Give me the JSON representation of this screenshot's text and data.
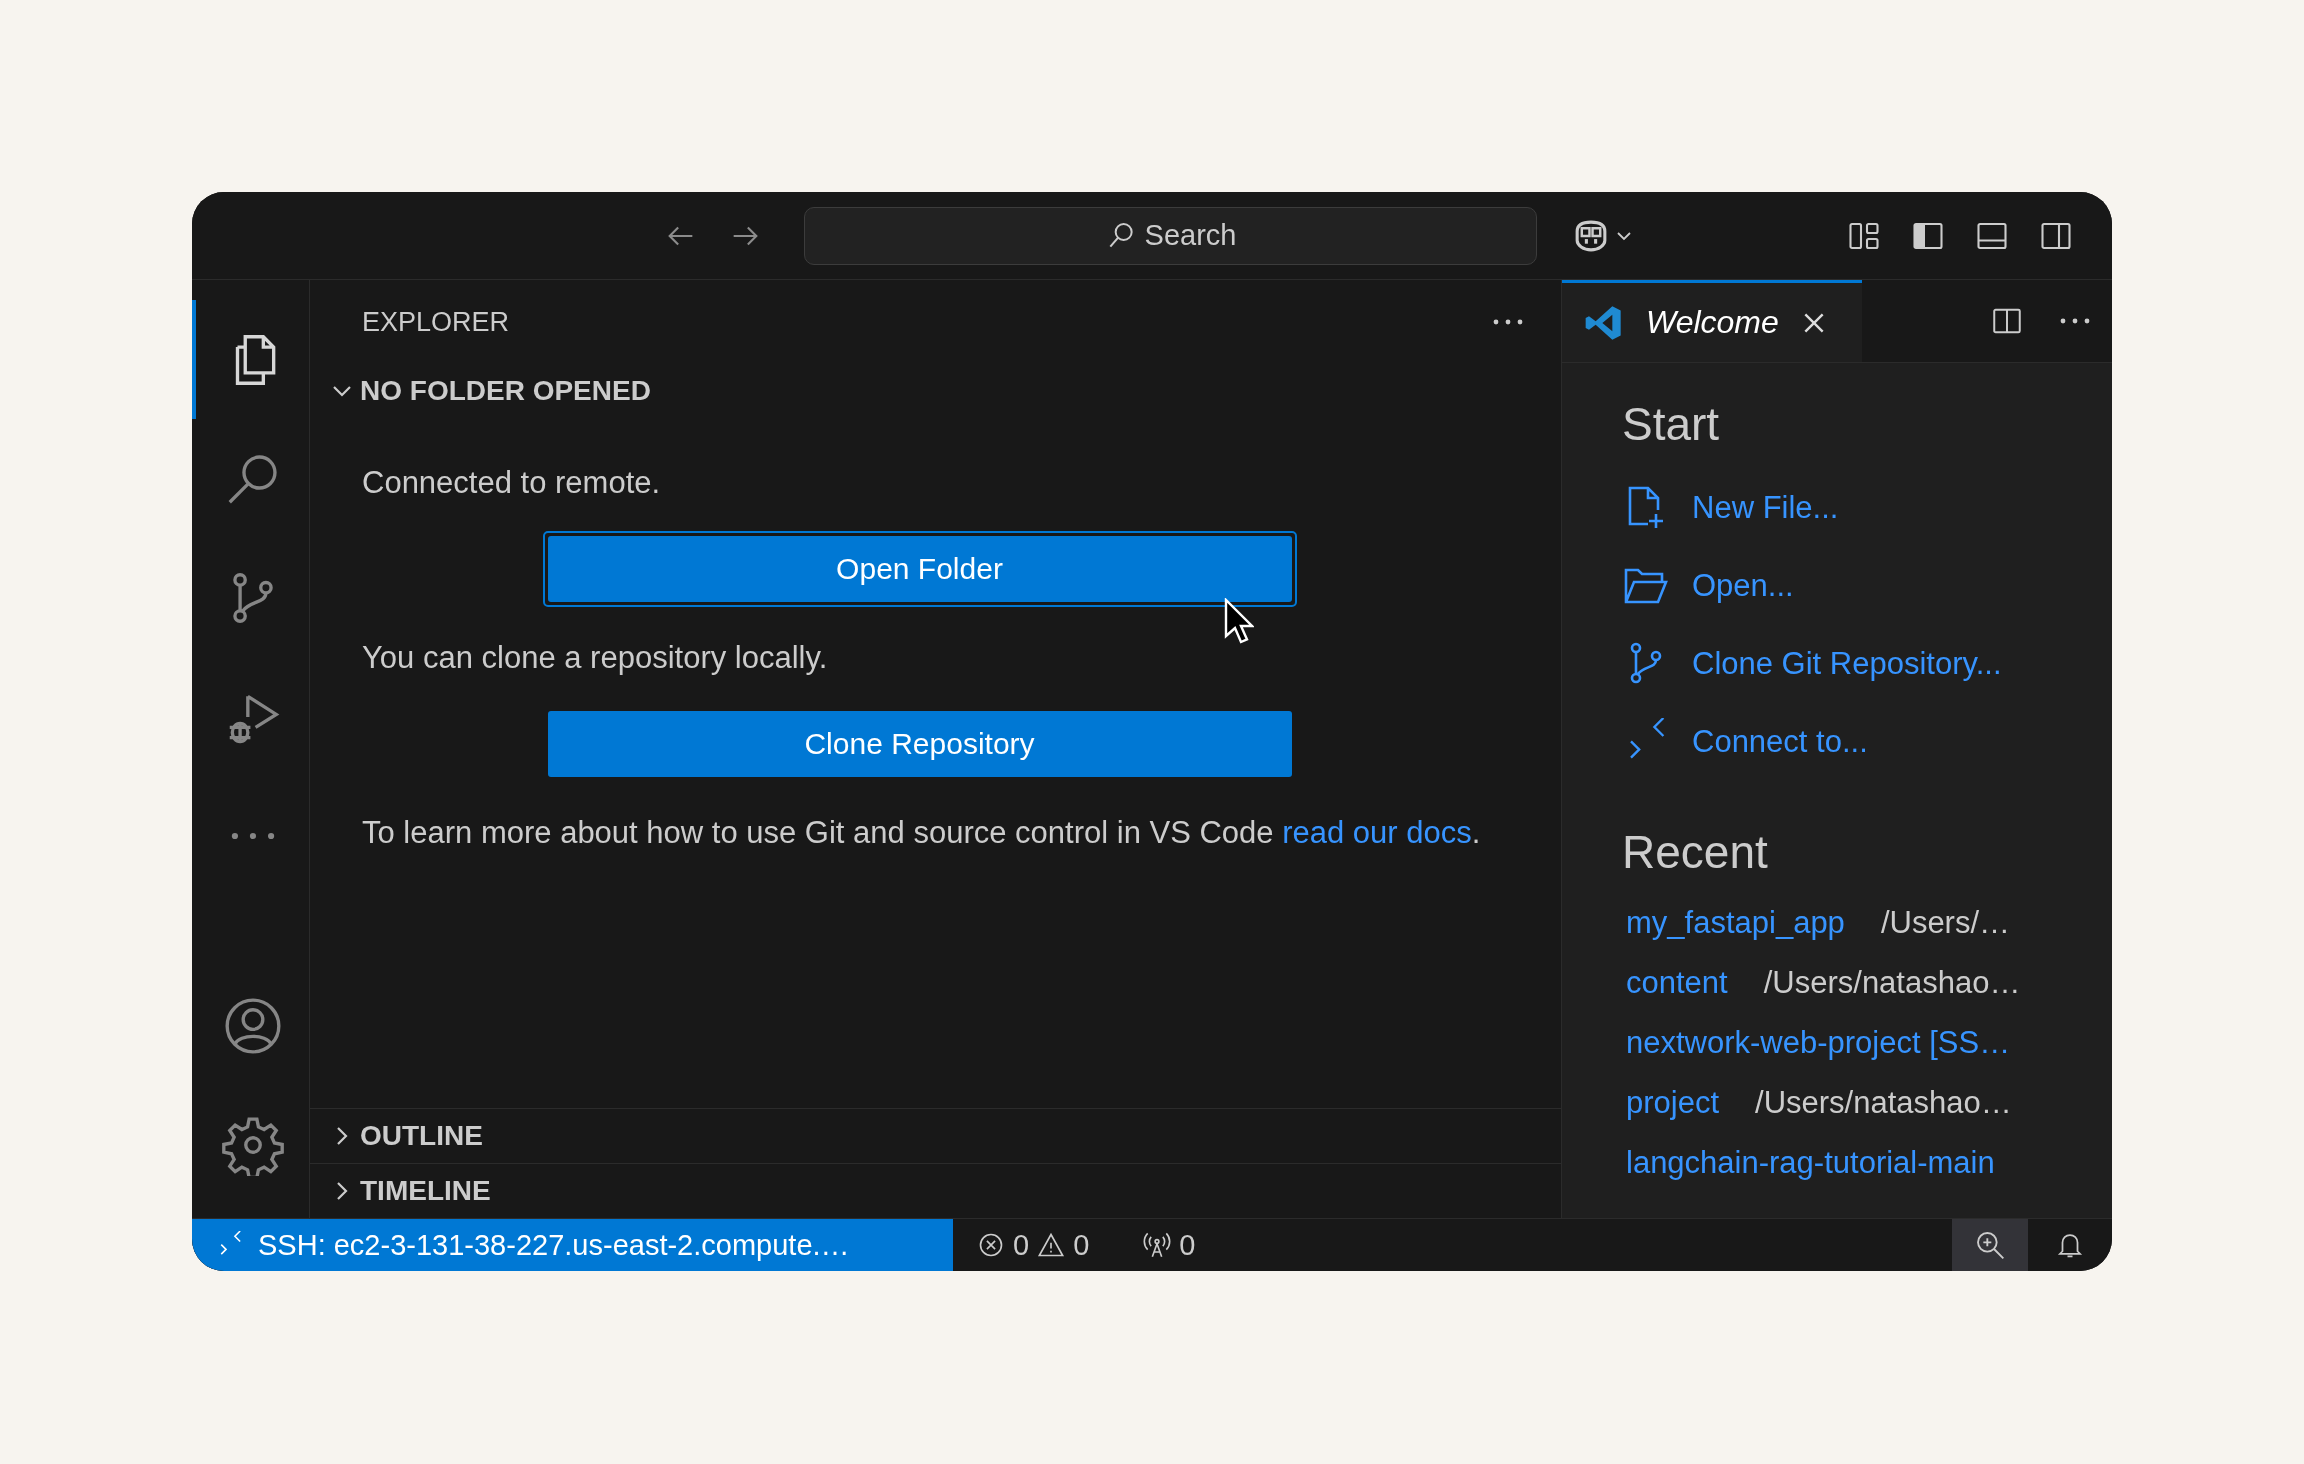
{
  "title_bar": {
    "search": {
      "placeholder": "Search"
    }
  },
  "activity_bar": {
    "items": [
      {
        "selected": true
      },
      {
        "selected": false
      },
      {
        "selected": false
      },
      {
        "selected": false
      },
      {
        "selected": false
      }
    ]
  },
  "sidebar": {
    "title": "EXPLORER",
    "sections": [
      {
        "title": "NO FOLDER OPENED",
        "expanded": true
      },
      {
        "title": "OUTLINE",
        "expanded": false
      },
      {
        "title": "TIMELINE",
        "expanded": false
      }
    ],
    "content": [
      {
        "kind": "text",
        "text": "Connected to remote."
      },
      {
        "kind": "button",
        "label": "Open Folder",
        "focused": true
      },
      {
        "kind": "text",
        "text": "You can clone a repository locally."
      },
      {
        "kind": "button",
        "label": "Clone Repository",
        "focused": false
      },
      {
        "kind": "text",
        "text": "To learn more about how to use Git and source control in VS Code ",
        "link": "read our docs",
        "after": "."
      }
    ]
  },
  "editor": {
    "tabs": [
      {
        "label": "Welcome",
        "selected": true
      }
    ],
    "start": {
      "title": "Start",
      "items": [
        {
          "label": "New File..."
        },
        {
          "label": "Open..."
        },
        {
          "label": "Clone Git Repository..."
        },
        {
          "label": "Connect to..."
        }
      ]
    },
    "recent": {
      "title": "Recent",
      "items": [
        {
          "name": "my_fastapi_app",
          "path": "/Users/…"
        },
        {
          "name": "content",
          "path": "/Users/natashao…"
        },
        {
          "name": "nextwork-web-project [SS…"
        },
        {
          "name": "project",
          "path": "/Users/natashao…"
        },
        {
          "name": "langchain-rag-tutorial-main"
        }
      ]
    }
  },
  "status_bar": {
    "remote": "SSH: ec2-3-131-38-227.us-east-2.compute.…",
    "errors": "0",
    "warnings": "0",
    "ports": "0"
  }
}
